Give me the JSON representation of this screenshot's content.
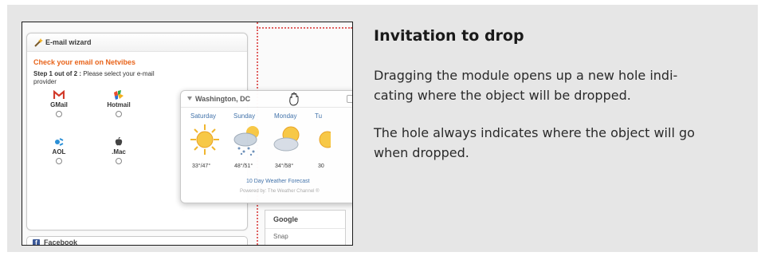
{
  "heading": "Invitation to drop",
  "paragraphs": [
    [
      "Dragging the module opens up a new hole indi-",
      "cating where the object will be dropped."
    ],
    [
      "The hole always indicates where the object will go",
      "when dropped."
    ]
  ],
  "screenshot": {
    "wizard": {
      "title": "E-mail wizard",
      "headline": "Check your email on Netvibes",
      "step_bold": "Step 1 out of 2 :",
      "step_text": " Please select your e-mail",
      "step_text_2": "provider",
      "providers": [
        {
          "name": "GMail",
          "icon": "gmail-icon"
        },
        {
          "name": "Hotmail",
          "icon": "hotmail-icon"
        },
        {
          "name": "AOL",
          "icon": "aol-icon"
        },
        {
          "name": ".Mac",
          "icon": "apple-icon"
        }
      ]
    },
    "weather": {
      "location": "Washington, DC",
      "days": [
        "Saturday",
        "Sunday",
        "Monday",
        "Tu"
      ],
      "temps": [
        "33°/47°",
        "48°/51°",
        "34°/58°",
        "30"
      ],
      "forecast_link": "10 Day Weather Forecast",
      "powered": "Powered by: The Weather Channel ®"
    },
    "google_module": {
      "title": "Google",
      "snap": "Snap"
    },
    "facebook_module": {
      "title": "Facebook"
    }
  }
}
